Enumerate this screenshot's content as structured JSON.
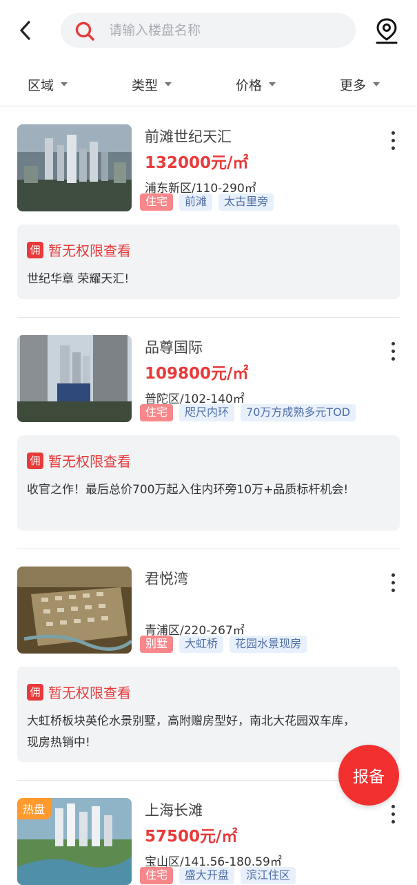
{
  "search": {
    "placeholder": "请输入楼盘名称"
  },
  "filters": [
    {
      "label": "区域"
    },
    {
      "label": "类型"
    },
    {
      "label": "价格"
    },
    {
      "label": "更多"
    }
  ],
  "listings": [
    {
      "name": "前滩世纪天汇",
      "price": "132000元/㎡",
      "area": "浦东新区/110-290㎡",
      "type_tag": "住宅",
      "tags": [
        "前滩",
        "太古里旁"
      ],
      "commission": "暂无权限查看",
      "description": "世纪华章 荣耀天汇!"
    },
    {
      "name": "品尊国际",
      "price": "109800元/㎡",
      "area": "普陀区/102-140㎡",
      "type_tag": "住宅",
      "tags": [
        "咫尺内环",
        "70万方成熟多元TOD"
      ],
      "commission": "暂无权限查看",
      "description": "收官之作！最后总价700万起入住内环旁10万+品质标杆机会!"
    },
    {
      "name": "君悦湾",
      "price": "",
      "area": "青浦区/220-267㎡",
      "type_tag": "别墅",
      "tags": [
        "大虹桥",
        "花园水景现房"
      ],
      "commission": "暂无权限查看",
      "description": "大虹桥板块英伦水景别墅，高附赠房型好，南北大花园双车库，现房热销中!"
    },
    {
      "name": "上海长滩",
      "price": "57500元/㎡",
      "area": "宝山区/141.56-180.59㎡",
      "type_tag": "住宅",
      "tags": [
        "盛大开盘",
        "滨江住区"
      ],
      "badge": "热盘"
    }
  ],
  "commission_badge": "佣",
  "report_button": "报备",
  "colors": {
    "accent": "#e83a3a",
    "tag_bg": "#e8f0fb",
    "tag_text": "#4f6fa8",
    "hot": "#ff9a2e"
  }
}
